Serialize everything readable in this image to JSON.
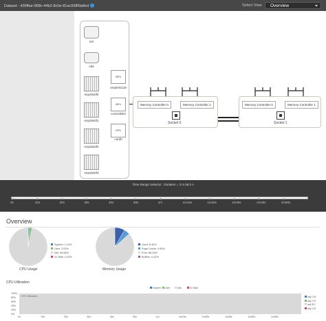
{
  "header": {
    "dataset_label": "Dataset : 430ffae-968c-44b2-8c0e-81ac938f9a8ed",
    "select_view_label": "Select View",
    "select_view_value": "Overview"
  },
  "topology": {
    "devices": [
      {
        "label": "sr0",
        "icon": "optical-drive-icon"
      },
      {
        "label": "sda",
        "icon": "disk-icon"
      },
      {
        "label": "enp26s0f0",
        "icon": "nic-icon"
      },
      {
        "label": "enp26s0f1",
        "icon": "nic-icon"
      },
      {
        "label": "enp26s0f2",
        "icon": "nic-icon"
      },
      {
        "label": "enp26s0f3",
        "icon": "nic-icon"
      }
    ],
    "small_devices": [
      {
        "label": "readerD128",
        "chip": "NPU"
      },
      {
        "label": "controlD64",
        "chip": "NPU"
      },
      {
        "label": "card0",
        "chip": "GPU"
      }
    ],
    "sockets": [
      {
        "label": "Socket 0",
        "controllers": [
          "Memory Controller 0",
          "Memory Controller 1"
        ]
      },
      {
        "label": "Socket 1",
        "controllers": [
          "Memory Controller 0",
          "Memory Controller 1"
        ]
      }
    ]
  },
  "timeline": {
    "title": "Time Range Selector : Duration = 3 m 58.0 s",
    "ticks": [
      "0s",
      "10s",
      "20s",
      "30s",
      "40s",
      "50s",
      "1m",
      "1m10s",
      "1m20s",
      "1m30s",
      "1m40s",
      "1m50s"
    ]
  },
  "overview": {
    "title": "Overview",
    "cpu_pie": {
      "label": "CPU Usage",
      "legend": [
        {
          "label": "System: 1.10%",
          "color": "#3b7dbf"
        },
        {
          "label": "User: 2.09%",
          "color": "#7dbf6a"
        },
        {
          "label": "Idle: 96.66%",
          "color": "#d9d9d9"
        },
        {
          "label": "IO Wait: 0.15%",
          "color": "#c94a6a"
        }
      ],
      "slices": [
        1.1,
        2.09,
        96.66,
        0.15
      ]
    },
    "mem_pie": {
      "label": "Memory Usage",
      "legend": [
        {
          "label": "Used: 8.40%",
          "color": "#3b5fa8"
        },
        {
          "label": "Page Cache: 4.95%",
          "color": "#5b9bd5"
        },
        {
          "label": "Free: 86.23%",
          "color": "#d9d9d9"
        },
        {
          "label": "Buffers: 0.42%",
          "color": "#9a5fa8"
        }
      ],
      "slices": [
        8.4,
        4.95,
        86.23,
        0.42
      ]
    },
    "cpu_util": {
      "title": "CPU Utilization",
      "series_legend": [
        {
          "label": "System",
          "color": "#3b7dbf"
        },
        {
          "label": "User",
          "color": "#7dbf6a"
        },
        {
          "label": "Idle",
          "color": "#d9d9d9"
        },
        {
          "label": "IO Wait",
          "color": "#c94a6a"
        }
      ],
      "y_ticks": [
        "100%",
        "80%",
        "60%",
        "40%",
        "20%",
        "0%"
      ],
      "x_ticks": [
        "0s",
        "10s",
        "20s",
        "30s",
        "40s",
        "50s",
        "1m",
        "1m10s",
        "1m20s",
        "1m30s",
        "1m40s",
        "1m50s"
      ],
      "plot_note": "CPU Utilization",
      "right_legend": [
        {
          "label": "avg 1.05",
          "color": "#3b7dbf"
        },
        {
          "label": "avg 2.01",
          "color": "#7dbf6a"
        },
        {
          "label": "avg 96.7",
          "color": "#d9d9d9"
        },
        {
          "label": "avg 0.15",
          "color": "#c94a6a"
        }
      ]
    }
  }
}
